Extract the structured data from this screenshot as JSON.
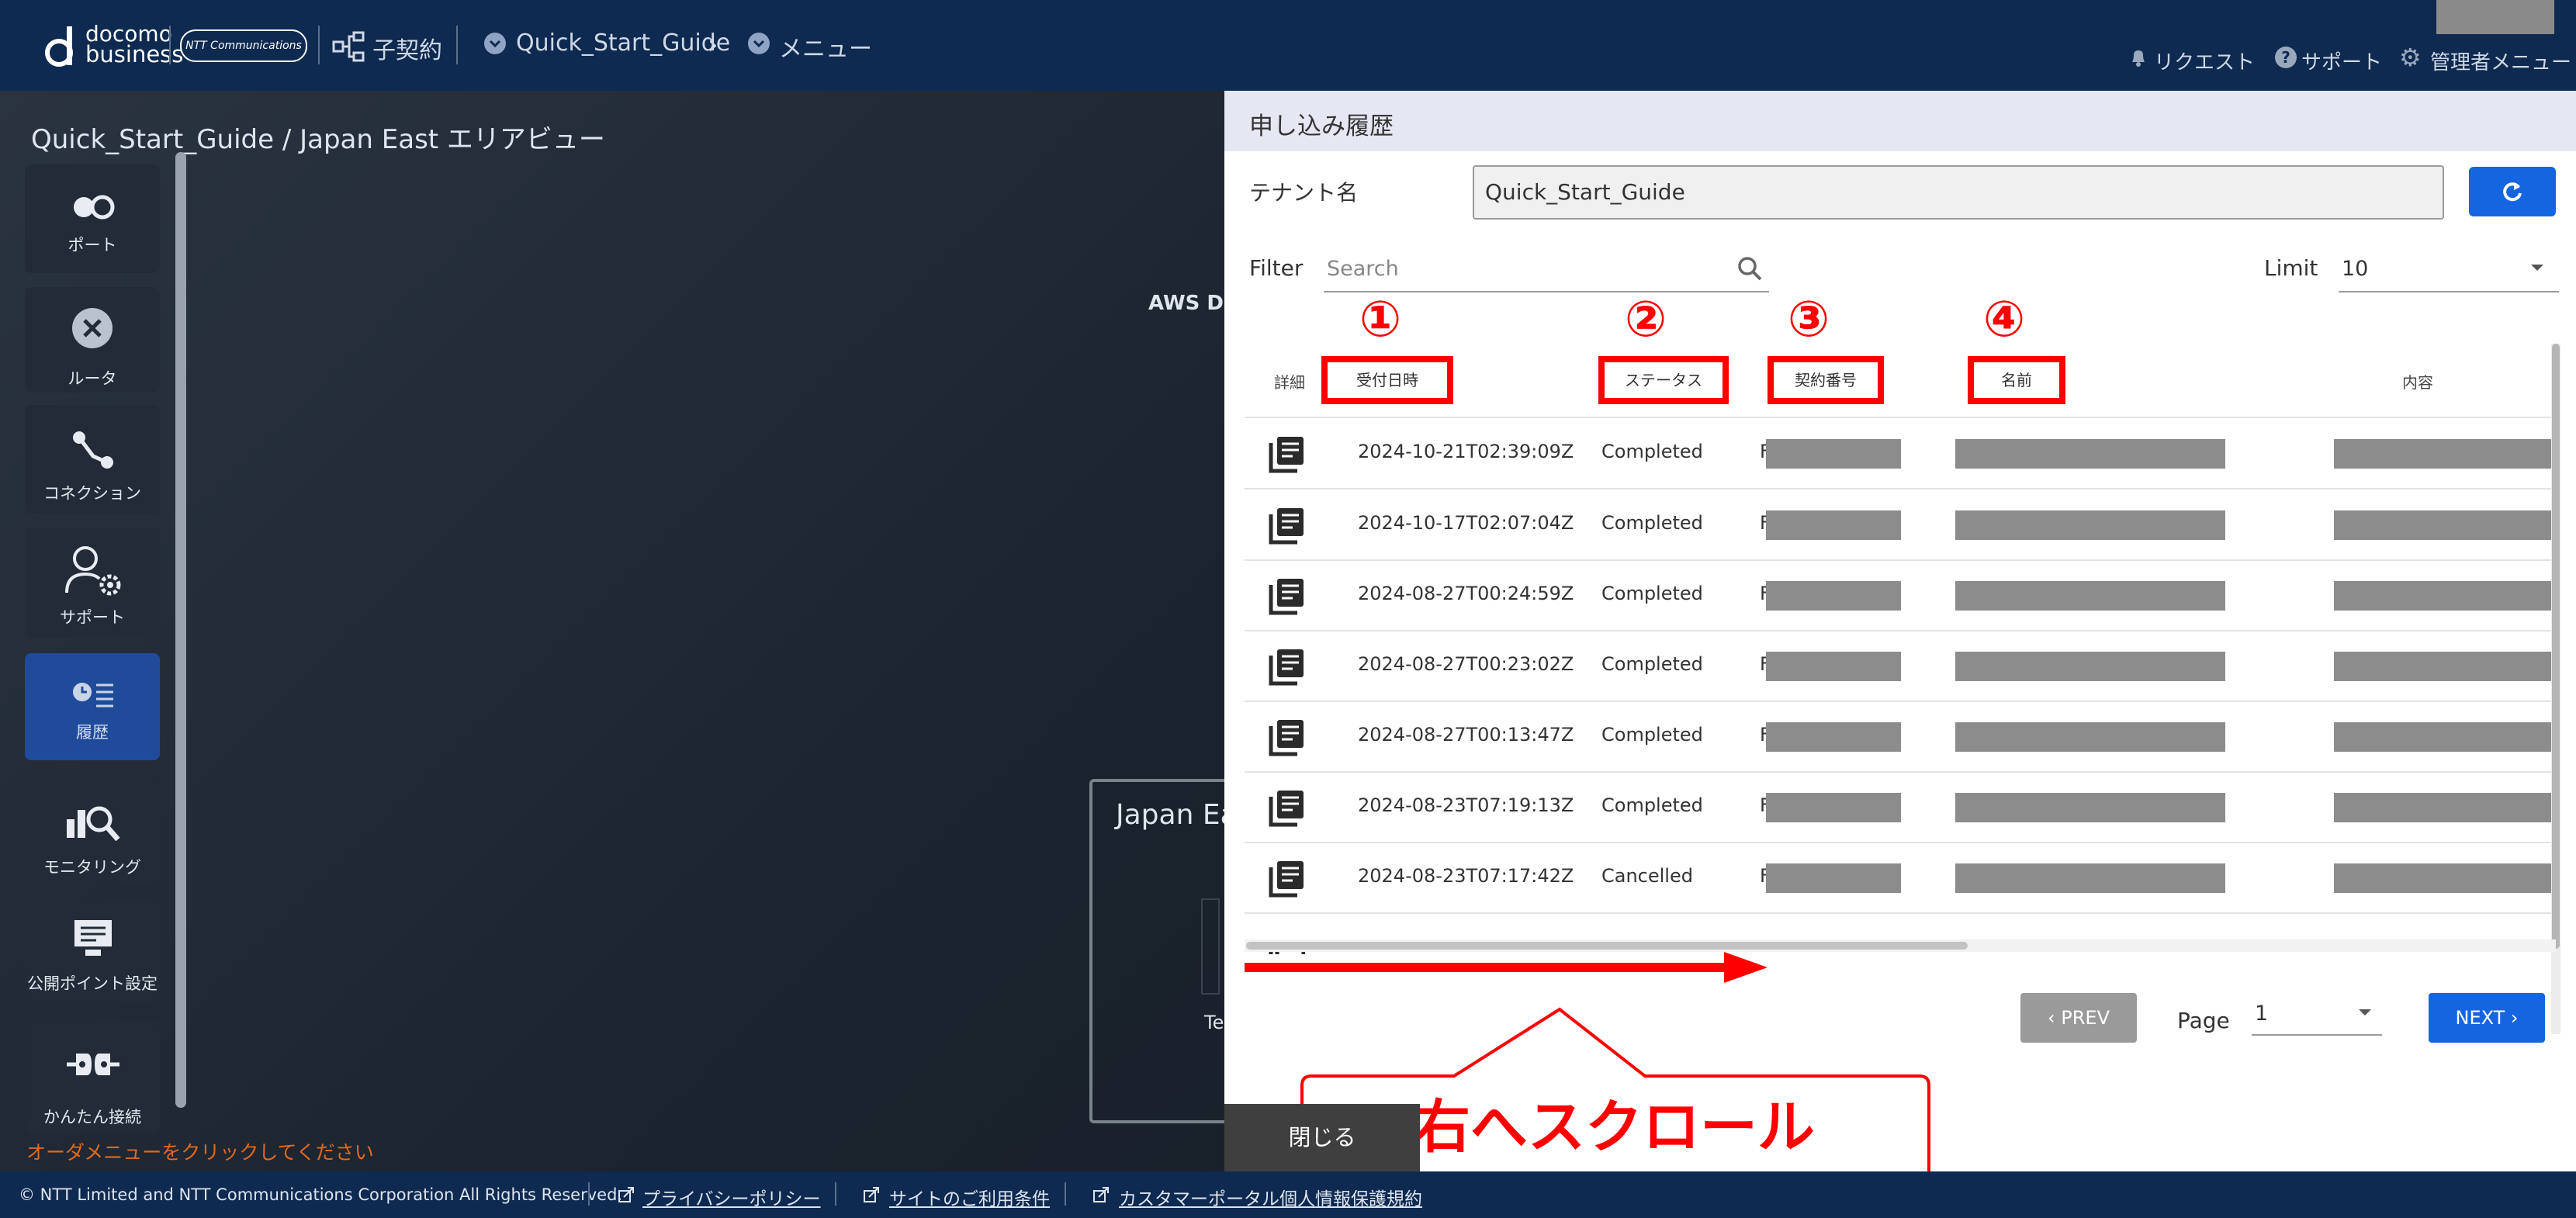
{
  "header": {
    "brand_line1": "docomo",
    "brand_line2": "business",
    "ntt_logo": "NTT Communications",
    "sub_contract": "子契約",
    "breadcrumb": [
      "Quick_Start_Guide",
      "メニュー"
    ],
    "request": "リクエスト",
    "support": "サポート",
    "admin_menu": "管理者メニュー"
  },
  "page_title": "Quick_Start_Guide / Japan East エリアビュー",
  "sidebar": {
    "items": [
      {
        "label": "ポート",
        "icon": "port-icon"
      },
      {
        "label": "ルータ",
        "icon": "router-icon"
      },
      {
        "label": "コネクション",
        "icon": "connection-icon"
      },
      {
        "label": "サポート",
        "icon": "support-user-icon"
      },
      {
        "label": "履歴",
        "icon": "history-icon"
      },
      {
        "label": "モニタリング",
        "icon": "monitoring-icon"
      },
      {
        "label": "公開ポイント設定",
        "icon": "public-point-icon"
      },
      {
        "label": "かんたん接続",
        "icon": "easy-connect-icon"
      }
    ]
  },
  "order_hint": "オーダメニューをクリックしてください",
  "bg_labels": {
    "aws": "AWS Dir",
    "japan_east": "Japan Ea",
    "te": "Te"
  },
  "modal": {
    "title": "申し込み履歴",
    "tenant_label": "テナント名",
    "tenant_value": "Quick_Start_Guide",
    "filter_label": "Filter",
    "search_placeholder": "Search",
    "limit_label": "Limit",
    "limit_value": "10",
    "columns": [
      "詳細",
      "受付日時",
      "ステータス",
      "契約番号",
      "名前",
      "内容"
    ],
    "rows": [
      {
        "date": "2024-10-21T02:39:09Z",
        "status": "Completed",
        "contract_prefix": "F"
      },
      {
        "date": "2024-10-17T02:07:04Z",
        "status": "Completed",
        "contract_prefix": "F"
      },
      {
        "date": "2024-08-27T00:24:59Z",
        "status": "Completed",
        "contract_prefix": "F"
      },
      {
        "date": "2024-08-27T00:23:02Z",
        "status": "Completed",
        "contract_prefix": "F"
      },
      {
        "date": "2024-08-27T00:13:47Z",
        "status": "Completed",
        "contract_prefix": "F"
      },
      {
        "date": "2024-08-23T07:19:13Z",
        "status": "Completed",
        "contract_prefix": "F"
      },
      {
        "date": "2024-08-23T07:17:42Z",
        "status": "Cancelled",
        "contract_prefix": "F"
      }
    ],
    "prev": "PREV",
    "next": "NEXT",
    "page_label": "Page",
    "page_value": "1",
    "close": "閉じる"
  },
  "annotations": {
    "markers": [
      "①",
      "②",
      "③",
      "④"
    ],
    "scroll_callout": "右へスクロール",
    "color": "#ff0000"
  },
  "footer": {
    "copyright": "© NTT Limited and NTT Communications Corporation All Rights Reserved.",
    "links": [
      "プライバシーポリシー",
      "サイトのご利用条件",
      "カスタマーポータル個人情報保護規約"
    ]
  },
  "colors": {
    "nav": "#0f2a50",
    "accent": "#1565e0",
    "active_side": "#1f4b9a"
  }
}
